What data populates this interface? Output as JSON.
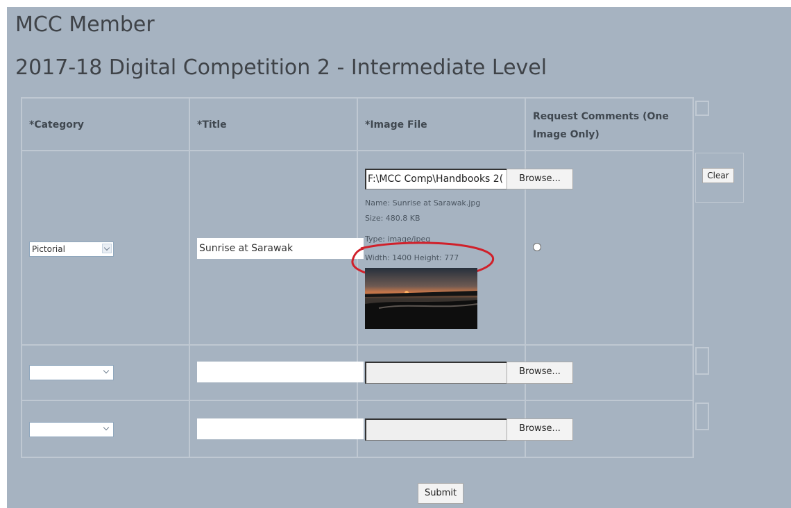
{
  "header": {
    "member_title": "MCC Member",
    "competition_title": "2017-18 Digital Competition 2 - Intermediate Level"
  },
  "table": {
    "columns": [
      "*Category",
      "*Title",
      "*Image File",
      "Request Comments (One",
      "Image Only)"
    ],
    "rows": [
      {
        "category": "Pictorial",
        "title": "Sunrise at Sarawak",
        "file_path": "F:\\MCC Comp\\Handbooks 2(",
        "browse_label": "Browse...",
        "file_info": {
          "name": "Name: Sunrise at Sarawak.jpg",
          "size": "Size: 480.8 KB",
          "type": "Type: image/jpeg",
          "dimensions": "Width: 1400 Height: 777"
        },
        "clear_label": "Clear"
      },
      {
        "category": "",
        "title": "",
        "file_path": "",
        "browse_label": "Browse..."
      },
      {
        "category": "",
        "title": "",
        "file_path": "",
        "browse_label": "Browse..."
      }
    ]
  },
  "submit_label": "Submit",
  "colors": {
    "background": "#a6b3c1",
    "annotation": "#d0202a",
    "grid": "#bfc8d2"
  },
  "icons": [
    "chevron-down-icon",
    "radio-icon",
    "image-thumbnail"
  ]
}
